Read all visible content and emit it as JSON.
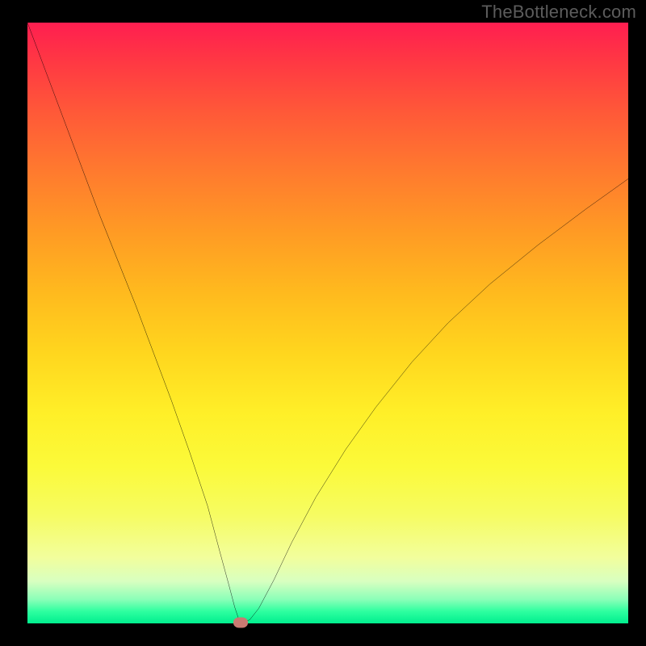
{
  "watermark": "TheBottleneck.com",
  "chart_data": {
    "type": "line",
    "title": "",
    "xlabel": "",
    "ylabel": "",
    "xlim": [
      0,
      100
    ],
    "ylim": [
      0,
      100
    ],
    "grid": false,
    "legend": null,
    "x": [
      0,
      3,
      6,
      9,
      12,
      15,
      18,
      21,
      24,
      27,
      30,
      32,
      33.5,
      34.5,
      35.2,
      36,
      37,
      38.5,
      41,
      44,
      48,
      53,
      58,
      64,
      70,
      77,
      85,
      93,
      100
    ],
    "values": [
      100,
      92,
      84,
      76,
      68,
      60.5,
      53,
      45,
      37,
      28.5,
      19.5,
      12,
      6.5,
      2.7,
      0.6,
      0.2,
      0.6,
      2.5,
      7.2,
      13.5,
      21,
      29,
      36,
      43.5,
      50,
      56.5,
      63,
      69,
      74
    ],
    "marker": {
      "x": 35.5,
      "y": 0.2
    },
    "gradient_meaning": "visual heatmap backdrop (red high → green low)"
  },
  "colors": {
    "curve": "#000000",
    "marker": "#c97a72",
    "frame": "#000000"
  }
}
